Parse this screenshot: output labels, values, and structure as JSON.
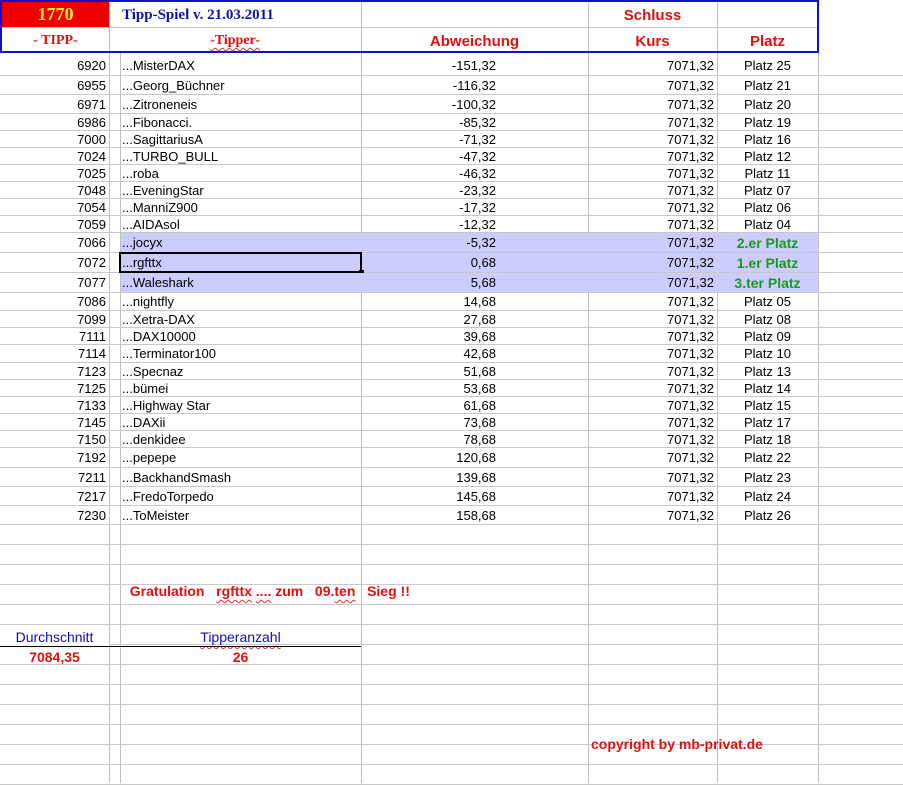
{
  "header": {
    "tipp_number": "1770",
    "title": "Tipp-Spiel v. 21.03.2011",
    "schluss": "Schluss",
    "col_tipp": "- TIPP-",
    "col_tipper": "-Tipper-",
    "col_abweichung": "Abweichung",
    "col_kurs": "Kurs",
    "col_platz": "Platz"
  },
  "colors": {
    "accent_red": "#ee0000",
    "title_blue": "#1111aa",
    "highlight": "#ccccff",
    "green": "#1a9a1a"
  },
  "rows": [
    {
      "tipp": "6920",
      "tipper": "...MisterDAX",
      "abw": "-151,32",
      "kurs": "7071,32",
      "platz": "Platz 25"
    },
    {
      "tipp": "6955",
      "tipper": "...Georg_Büchner",
      "abw": "-116,32",
      "kurs": "7071,32",
      "platz": "Platz 21"
    },
    {
      "tipp": "6971",
      "tipper": "...Zitroneneis",
      "abw": "-100,32",
      "kurs": "7071,32",
      "platz": "Platz 20"
    },
    {
      "tipp": "6986",
      "tipper": "...Fibonacci.",
      "abw": "-85,32",
      "kurs": "7071,32",
      "platz": "Platz 19"
    },
    {
      "tipp": "7000",
      "tipper": "...SagittariusA",
      "abw": "-71,32",
      "kurs": "7071,32",
      "platz": "Platz 16"
    },
    {
      "tipp": "7024",
      "tipper": "...TURBO_BULL",
      "abw": "-47,32",
      "kurs": "7071,32",
      "platz": "Platz 12"
    },
    {
      "tipp": "7025",
      "tipper": "...roba",
      "abw": "-46,32",
      "kurs": "7071,32",
      "platz": "Platz 11"
    },
    {
      "tipp": "7048",
      "tipper": "...EveningStar",
      "abw": "-23,32",
      "kurs": "7071,32",
      "platz": "Platz 07"
    },
    {
      "tipp": "7054",
      "tipper": "...ManniZ900",
      "abw": "-17,32",
      "kurs": "7071,32",
      "platz": "Platz 06"
    },
    {
      "tipp": "7059",
      "tipper": "...AIDAsol",
      "abw": "-12,32",
      "kurs": "7071,32",
      "platz": "Platz 04"
    },
    {
      "tipp": "7066",
      "tipper": "...jocyx",
      "abw": "-5,32",
      "kurs": "7071,32",
      "platz": "2.er Platz",
      "top": true
    },
    {
      "tipp": "7072",
      "tipper": "...rgfttx",
      "abw": "0,68",
      "kurs": "7071,32",
      "platz": "1.er Platz",
      "top": true,
      "selected": true
    },
    {
      "tipp": "7077",
      "tipper": "...Waleshark",
      "abw": "5,68",
      "kurs": "7071,32",
      "platz": "3.ter Platz",
      "top": true
    },
    {
      "tipp": "7086",
      "tipper": "...nightfly",
      "abw": "14,68",
      "kurs": "7071,32",
      "platz": "Platz 05"
    },
    {
      "tipp": "7099",
      "tipper": "...Xetra-DAX",
      "abw": "27,68",
      "kurs": "7071,32",
      "platz": "Platz 08"
    },
    {
      "tipp": "7111",
      "tipper": "...DAX10000",
      "abw": "39,68",
      "kurs": "7071,32",
      "platz": "Platz 09"
    },
    {
      "tipp": "7114",
      "tipper": "...Terminator100",
      "abw": "42,68",
      "kurs": "7071,32",
      "platz": "Platz 10"
    },
    {
      "tipp": "7123",
      "tipper": "...Specnaz",
      "abw": "51,68",
      "kurs": "7071,32",
      "platz": "Platz 13"
    },
    {
      "tipp": "7125",
      "tipper": "...bümei",
      "abw": "53,68",
      "kurs": "7071,32",
      "platz": "Platz 14"
    },
    {
      "tipp": "7133",
      "tipper": "...Highway Star",
      "abw": "61,68",
      "kurs": "7071,32",
      "platz": "Platz 15"
    },
    {
      "tipp": "7145",
      "tipper": "...DAXii",
      "abw": "73,68",
      "kurs": "7071,32",
      "platz": "Platz 17"
    },
    {
      "tipp": "7150",
      "tipper": "...denkidee",
      "abw": "78,68",
      "kurs": "7071,32",
      "platz": "Platz 18"
    },
    {
      "tipp": "7192",
      "tipper": "...pepepe",
      "abw": "120,68",
      "kurs": "7071,32",
      "platz": "Platz 22"
    },
    {
      "tipp": "7211",
      "tipper": "...BackhandSmash",
      "abw": "139,68",
      "kurs": "7071,32",
      "platz": "Platz 23"
    },
    {
      "tipp": "7217",
      "tipper": "...FredoTorpedo",
      "abw": "145,68",
      "kurs": "7071,32",
      "platz": "Platz 24"
    },
    {
      "tipp": "7230",
      "tipper": "...ToMeister",
      "abw": "158,68",
      "kurs": "7071,32",
      "platz": "Platz 26"
    }
  ],
  "gratulation": {
    "pre": "Gratulation",
    "name": "rgfttx",
    "dots": "....",
    "zum": "zum",
    "num": "09.",
    "ten": "ten",
    "sieg": "Sieg",
    "bang": "!!"
  },
  "stats": {
    "avg_label": "Durchschnitt",
    "avg_value": "7084,35",
    "count_label": "Tipperanzahl",
    "count_value": "26"
  },
  "copyright": "copyright by mb-privat.de"
}
